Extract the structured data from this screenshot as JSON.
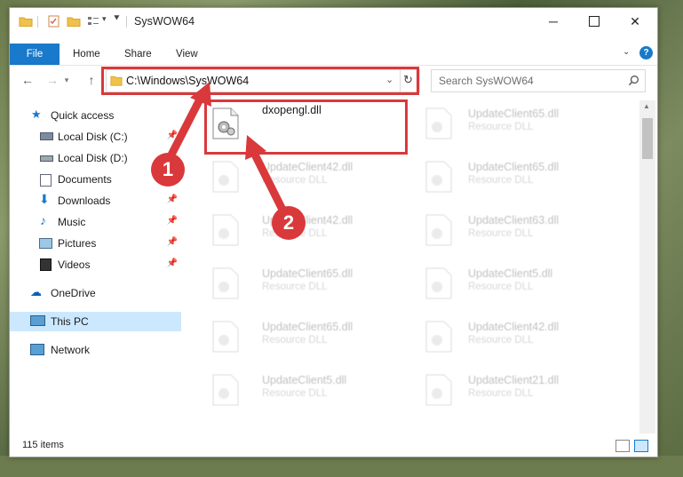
{
  "window": {
    "title": "SysWOW64"
  },
  "ribbon": {
    "tabs": [
      "File",
      "Home",
      "Share",
      "View"
    ]
  },
  "nav": {
    "address": "C:\\Windows\\SysWOW64",
    "search_placeholder": "Search SysWOW64"
  },
  "sidebar": {
    "items": [
      {
        "label": "Quick access",
        "icon": "star-icon",
        "pinned": false
      },
      {
        "label": "Local Disk (C:)",
        "icon": "drive-icon",
        "pinned": true
      },
      {
        "label": "Local Disk (D:)",
        "icon": "drive-icon",
        "pinned": false
      },
      {
        "label": "Documents",
        "icon": "documents-icon",
        "pinned": false
      },
      {
        "label": "Downloads",
        "icon": "download-icon",
        "pinned": true
      },
      {
        "label": "Music",
        "icon": "music-icon",
        "pinned": true
      },
      {
        "label": "Pictures",
        "icon": "pictures-icon",
        "pinned": true
      },
      {
        "label": "Videos",
        "icon": "videos-icon",
        "pinned": true
      },
      {
        "label": "OneDrive",
        "icon": "cloud-icon",
        "pinned": false
      },
      {
        "label": "This PC",
        "icon": "computer-icon",
        "pinned": false,
        "selected": true
      },
      {
        "label": "Network",
        "icon": "network-icon",
        "pinned": false
      }
    ]
  },
  "files": [
    {
      "name": "dxopengl.dll",
      "type": "",
      "highlighted": true
    },
    {
      "name": "UpdateClient65.dll",
      "type": "Resource DLL"
    },
    {
      "name": "UpdateClient42.dll",
      "type": "Resource DLL"
    },
    {
      "name": "UpdateClient65.dll",
      "type": "Resource DLL"
    },
    {
      "name": "UpdateClient42.dll",
      "type": "Resource DLL"
    },
    {
      "name": "UpdateClient63.dll",
      "type": "Resource DLL"
    },
    {
      "name": "UpdateClient65.dll",
      "type": "Resource DLL"
    },
    {
      "name": "UpdateClient5.dll",
      "type": "Resource DLL"
    },
    {
      "name": "UpdateClient65.dll",
      "type": "Resource DLL"
    },
    {
      "name": "UpdateClient42.dll",
      "type": "Resource DLL"
    },
    {
      "name": "UpdateClient5.dll",
      "type": "Resource DLL"
    },
    {
      "name": "UpdateClient21.dll",
      "type": "Resource DLL"
    }
  ],
  "status": {
    "count": "115 items"
  },
  "annotations": {
    "badge1": "1",
    "badge2": "2",
    "color": "#d9393b"
  }
}
